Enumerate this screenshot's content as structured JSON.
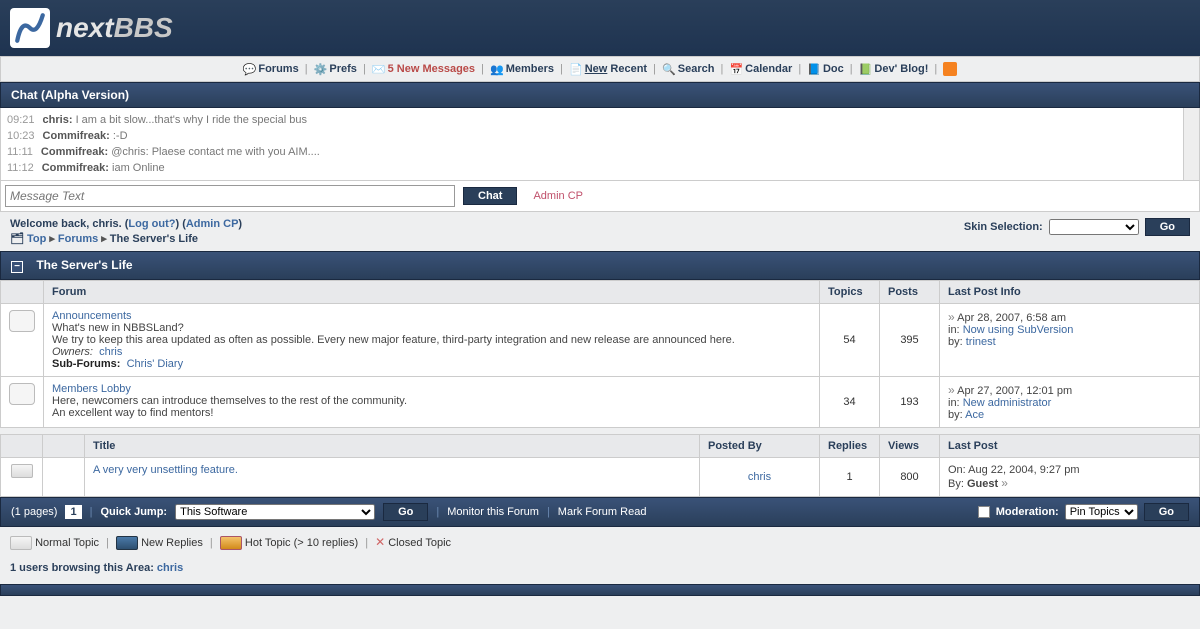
{
  "header": {
    "logo_main": "next",
    "logo_sub": "BBS"
  },
  "nav": {
    "forums": "Forums",
    "prefs": "Prefs",
    "messages_count": "5",
    "messages_label": "New Messages",
    "members": "Members",
    "new": "New",
    "recent": "Recent",
    "search": "Search",
    "calendar": "Calendar",
    "doc": "Doc",
    "devblog": "Dev' Blog!"
  },
  "chat": {
    "title": "Chat (Alpha Version)",
    "lines": [
      {
        "time": "09:21",
        "user": "chris:",
        "text": "I am a bit slow...that's why I ride the special bus"
      },
      {
        "time": "10:23",
        "user": "Commifreak:",
        "text": ":-D"
      },
      {
        "time": "11:11",
        "user": "Commifreak:",
        "text": "@chris: Plaese contact me with you AIM...."
      },
      {
        "time": "11:12",
        "user": "Commifreak:",
        "text": "iam Online"
      }
    ],
    "placeholder": "Message Text",
    "button": "Chat",
    "admin": "Admin CP"
  },
  "welcome": {
    "prefix": "Welcome back, ",
    "user": "chris",
    "dot": ". (",
    "logout": "Log out?",
    "mid": ") (",
    "admincp": "Admin CP",
    "end": ")"
  },
  "breadcrumb": {
    "top": "Top",
    "forums": "Forums",
    "current": "The Server's Life"
  },
  "skin": {
    "label": "Skin Selection:",
    "go": "Go"
  },
  "category": {
    "name": "The Server's Life"
  },
  "forum_headers": {
    "forum": "Forum",
    "topics": "Topics",
    "posts": "Posts",
    "last": "Last Post Info"
  },
  "forums": [
    {
      "name": "Announcements",
      "desc1": "What's new in NBBSLand?",
      "desc2": "We try to keep this area updated as often as possible. Every new major feature, third-party integration and new release are announced here.",
      "owners_label": "Owners:",
      "owners": "chris",
      "sub_label": "Sub-Forums:",
      "sub": "Chris' Diary",
      "topics": "54",
      "posts": "395",
      "last_date": "Apr 28, 2007, 6:58 am",
      "last_in_label": "in:",
      "last_in": "Now using SubVersion",
      "last_by_label": "by:",
      "last_by": "trinest"
    },
    {
      "name": "Members Lobby",
      "desc1": "Here, newcomers can introduce themselves to the rest of the community.",
      "desc2": "An excellent way to find mentors!",
      "topics": "34",
      "posts": "193",
      "last_date": "Apr 27, 2007, 12:01 pm",
      "last_in_label": "in:",
      "last_in": "New administrator",
      "last_by_label": "by:",
      "last_by": "Ace"
    }
  ],
  "topic_headers": {
    "title": "Title",
    "posted": "Posted By",
    "replies": "Replies",
    "views": "Views",
    "last": "Last Post"
  },
  "topics": [
    {
      "title": "A very very unsettling feature.",
      "posted_by": "chris",
      "replies": "1",
      "views": "800",
      "last_on_label": "On:",
      "last_on": "Aug 22, 2004, 9:27 pm",
      "last_by_label": "By:",
      "last_by": "Guest"
    }
  ],
  "pager": {
    "pages": "(1 pages)",
    "current": "1",
    "quick_label": "Quick Jump:",
    "quick_value": "This Software",
    "go": "Go",
    "monitor": "Monitor this Forum",
    "mark_read": "Mark Forum Read",
    "moderation_label": "Moderation:",
    "moderation_value": "Pin Topics",
    "go2": "Go"
  },
  "legend": {
    "normal": "Normal Topic",
    "new": "New Replies",
    "hot": "Hot Topic (> 10 replies)",
    "closed": "Closed Topic"
  },
  "browsing": {
    "text": "1 users browsing this Area:",
    "user": "chris"
  }
}
